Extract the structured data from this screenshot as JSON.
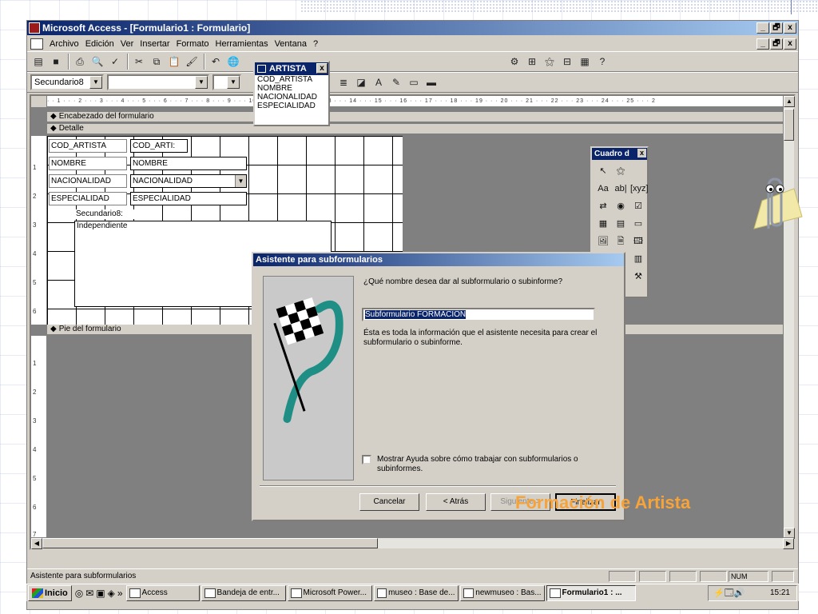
{
  "window": {
    "title": "Microsoft Access - [Formulario1 : Formulario]",
    "minimize": "_",
    "restore": "🗗",
    "close": "x"
  },
  "menu": {
    "items": [
      "Archivo",
      "Edición",
      "Ver",
      "Insertar",
      "Formato",
      "Herramientas",
      "Ventana",
      "?"
    ]
  },
  "toolbar2": {
    "object_combo": "Secundario8",
    "font_combo": "",
    "size_combo": ""
  },
  "field_list": {
    "title": "ARTISTA",
    "close": "x",
    "fields": [
      "COD_ARTISTA",
      "NOMBRE",
      "NACIONALIDAD",
      "ESPECIALIDAD"
    ]
  },
  "ruler": {
    "horizontal": "· · 1 · · · 2 · · · 3 · · · 4 · · · 5 · · · 6 · · · 7 · · · 8 · · · 9 · · · 10 · · · 11 · · · 12 · · · 13 · · · 14 · · · 15 · · · 16 · · · 17 · · · 18 · · · 19 · · · 20 · · · 21 · · · 22 · · · 23 · · · 24 · · · 25 · · · 2",
    "detail_marks": [
      "1",
      "2",
      "3",
      "4",
      "5",
      "6"
    ],
    "footer_marks": [
      "1",
      "2",
      "3",
      "4",
      "5",
      "6",
      "7"
    ]
  },
  "sections": {
    "header": "Encabezado del formulario",
    "detail": "Detalle",
    "footer": "Pie del formulario"
  },
  "form_controls": {
    "labels": [
      "COD_ARTISTA",
      "NOMBRE",
      "NACIONALIDAD",
      "ESPECIALIDAD"
    ],
    "fields": [
      "COD_ARTI:",
      "NOMBRE",
      "NACIONALIDAD",
      "ESPECIALIDAD"
    ],
    "subform_label": "Secundario8:",
    "subform_content": "Independiente"
  },
  "toolbox": {
    "title": "Cuadro d",
    "close": "x",
    "tools": [
      "↖",
      "⚝",
      "Aa",
      "ab|",
      "[xyz]",
      "⇄",
      "◉",
      "☑",
      "▦",
      "▤",
      "▭",
      "🖼",
      "🗎",
      "🖽",
      "",
      "",
      "▥",
      "",
      "",
      "⚒",
      ""
    ]
  },
  "dialog": {
    "title": "Asistente para subformularios",
    "question": "¿Qué nombre desea dar al subformulario o subinforme?",
    "name_value": "Subformulario FORMACION",
    "info": "Ésta es toda la información que el asistente necesita para crear el subformulario o subinforme.",
    "help_checkbox": "Mostrar Ayuda sobre cómo trabajar con subformularios o subinformes.",
    "cancel": "Cancelar",
    "back": "< Atrás",
    "next": "Siguiente >",
    "finish": "Finalizar"
  },
  "overlay_title": "Formación de Artista",
  "status": {
    "text": "Asistente para subformularios",
    "num": "NUM"
  },
  "taskbar": {
    "start": "Inicio",
    "quicklaunch_more": "»",
    "tasks": [
      "Access",
      "Bandeja de entr...",
      "Microsoft Power...",
      "museo : Base de...",
      "newmuseo : Bas...",
      "Formulario1 : ..."
    ],
    "clock": "15:21"
  },
  "colors": {
    "titlebar_start": "#0a246a",
    "titlebar_end": "#a6caf0",
    "chrome": "#d4d0c8",
    "overlay_title": "#f6a33a"
  }
}
